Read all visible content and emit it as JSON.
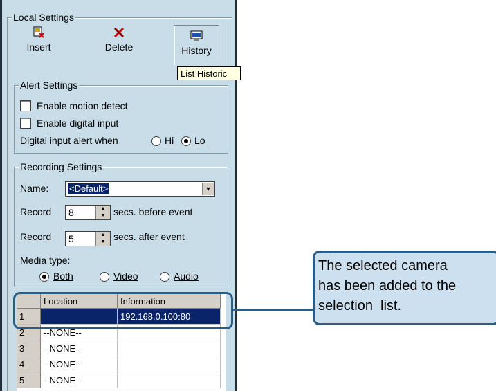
{
  "local_settings": {
    "title": "Local Settings",
    "toolbar": {
      "insert_label": "Insert",
      "delete_label": "Delete",
      "history_label": "History"
    },
    "tooltip": "List Historic"
  },
  "alert_settings": {
    "title": "Alert Settings",
    "motion_detect": {
      "label": "Enable motion detect",
      "checked": false
    },
    "digital_input": {
      "label": "Enable digital input",
      "checked": false
    },
    "alert_when_label": "Digital input alert when",
    "alert_options": [
      "Hi",
      "Lo"
    ],
    "alert_selected": "Lo"
  },
  "recording_settings": {
    "title": "Recording Settings",
    "name_label": "Name:",
    "name_value": "<Default>",
    "record_before": {
      "label": "Record",
      "value": "8",
      "suffix": "secs. before event"
    },
    "record_after": {
      "label": "Record",
      "value": "5",
      "suffix": "secs. after event"
    },
    "media_type_label": "Media type:",
    "media_options": [
      "Both",
      "Video",
      "Audio"
    ],
    "media_selected": "Both"
  },
  "camera_list": {
    "headers": [
      "Location",
      "Information"
    ],
    "rows": [
      {
        "num": "1",
        "location": "",
        "information": "192.168.0.100:80"
      },
      {
        "num": "2",
        "location": "--NONE--",
        "information": ""
      },
      {
        "num": "3",
        "location": "--NONE--",
        "information": ""
      },
      {
        "num": "4",
        "location": "--NONE--",
        "information": ""
      },
      {
        "num": "5",
        "location": "--NONE--",
        "information": ""
      }
    ]
  },
  "callout": {
    "lines": [
      "The selected camera",
      "has been added to the",
      "selection  list."
    ]
  },
  "colors": {
    "panel_bg": "#c9dde9",
    "selection": "#0a246a",
    "callout_border": "#2a5d86",
    "callout_bg": "#cde0ef"
  }
}
